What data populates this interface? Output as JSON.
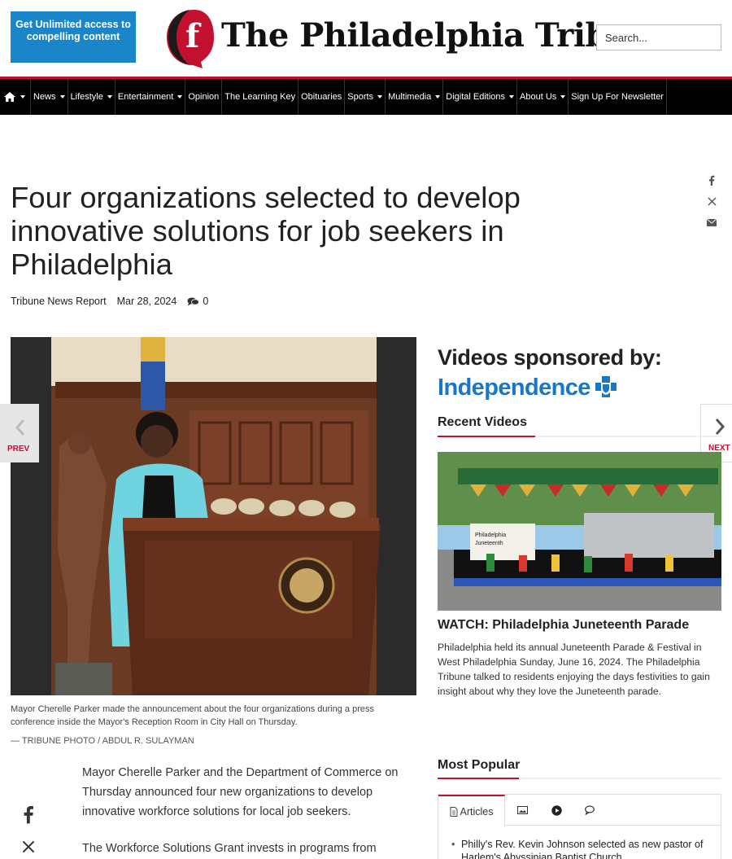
{
  "header": {
    "promo": "Get Unlimited access to compelling content",
    "logo_text": "The Philadelphia Tribune",
    "search_placeholder": "Search..."
  },
  "nav": {
    "items": [
      {
        "label": "News",
        "dropdown": true
      },
      {
        "label": "Lifestyle",
        "dropdown": true
      },
      {
        "label": "Entertainment",
        "dropdown": true
      },
      {
        "label": "Opinion",
        "dropdown": false
      },
      {
        "label": "The Learning Key",
        "dropdown": false
      },
      {
        "label": "Obituaries",
        "dropdown": false
      },
      {
        "label": "Sports",
        "dropdown": true
      },
      {
        "label": "Multimedia",
        "dropdown": true
      },
      {
        "label": "Digital Editions",
        "dropdown": true
      },
      {
        "label": "About Us",
        "dropdown": true
      },
      {
        "label": "Sign Up For Newsletter",
        "dropdown": false
      }
    ]
  },
  "article": {
    "title": "Four organizations selected to develop innovative solutions for job seekers in Philadelphia",
    "author": "Tribune News Report",
    "date": "Mar 28, 2024",
    "comment_count": "0",
    "caption": "Mayor Cherelle Parker made the announcement about the four organizations during a press conference inside the Mayor's Reception Room in City Hall on Thursday.",
    "credit": "— TRIBUNE PHOTO / ABDUL R. SULAYMAN",
    "paragraphs": [
      "Mayor Cherelle Parker and the Department of Commerce on Thursday announced four new organizations to develop innovative workforce solutions for local job seekers.",
      "The Workforce Solutions Grant invests in programs from"
    ]
  },
  "pager": {
    "prev": "PREV",
    "next": "NEXT"
  },
  "sidebar": {
    "sponsor_heading": "Videos sponsored by:",
    "sponsor_name": "Independence",
    "recent_videos_heading": "Recent Videos",
    "video_title": "WATCH: Philadelphia Juneteenth Parade",
    "video_description": "Philadelphia held its annual Juneteenth Parade & Festival in West Philadelphia Sunday, June 16, 2024. The Philadelphia Tribune talked to residents enjoying the days festivities to gain insight about why they love the Juneteenth parade.",
    "video_sign": "Philadelphia Parade Juneteenth & Festival",
    "most_popular_heading": "Most Popular",
    "tabs": {
      "articles": "Articles"
    },
    "popular_items": [
      "Philly's Rev. Kevin Johnson selected as new pastor of Harlem's Abyssinian Baptist Church"
    ]
  },
  "colors": {
    "accent": "#c3102f",
    "promo_blue": "#1a85c8",
    "sponsor_blue": "#1a76c7"
  }
}
